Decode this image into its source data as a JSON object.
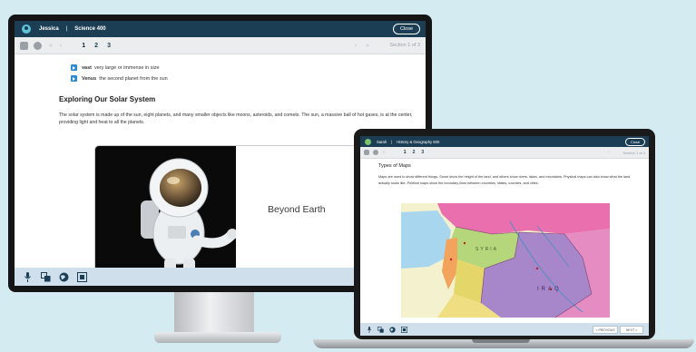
{
  "desktop": {
    "student": "Jessica",
    "separator": "|",
    "course": "Science 400",
    "close_label": "Close",
    "pages": [
      "1",
      "2",
      "3"
    ],
    "section_label": "Section 1 of 3",
    "vocab": [
      {
        "term": "vast",
        "definition": "very large or immense in size"
      },
      {
        "term": "Venus",
        "definition": "the second planet from the sun"
      }
    ],
    "heading": "Exploring Our Solar System",
    "paragraph": "The solar system is made up of the sun, eight planets, and many smaller objects like moons, asteroids, and comets. The sun, a massive ball of hot gases, is at the center, providing light and heat to all the planets.",
    "video_title": "Beyond Earth",
    "toolbar_icons": [
      "microphone-icon",
      "translate-icon",
      "globe-icon",
      "calculator-icon"
    ]
  },
  "laptop": {
    "student": "Sarah",
    "separator": "|",
    "course": "History & Geography 600",
    "close_label": "Close",
    "pages": [
      "1",
      "2",
      "3"
    ],
    "section_label": "Section 1 of 3",
    "heading": "Types of Maps",
    "paragraph": "Maps are used to show different things. Some show the height of the land, and others show rivers, lakes, and mountains. Physical maps can also show what the land actually looks like. Political maps show the boundary lines between countries, states, counties, and cities.",
    "map_labels": [
      "SYRIA",
      "IRAQ"
    ],
    "previous_label": "< PREVIOUS",
    "next_label": "NEXT >"
  }
}
